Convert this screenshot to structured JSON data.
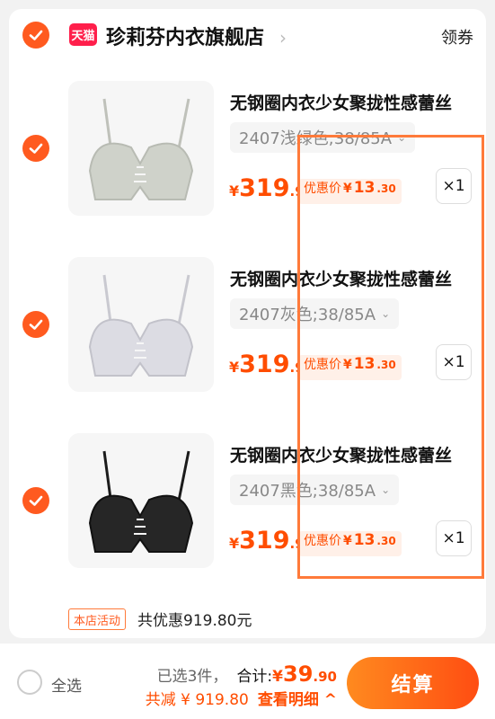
{
  "shop": {
    "badge": "天猫",
    "name": "珍莉芬内衣旗舰店",
    "coupon_label": "领券"
  },
  "items": [
    {
      "title": "无钢圈内衣少女聚拢性感蕾丝",
      "sku": "2407浅绿色;38/85A",
      "price_symbol": "¥",
      "price_int": "319",
      "price_dec": ".9",
      "promo_label": "优惠价",
      "promo_symbol": "¥",
      "promo_int": "13",
      "promo_dec": ".30",
      "qty": "×1",
      "color": "#d4d6cf"
    },
    {
      "title": "无钢圈内衣少女聚拢性感蕾丝",
      "sku": "2407灰色;38/85A",
      "price_symbol": "¥",
      "price_int": "319",
      "price_dec": ".9",
      "promo_label": "优惠价",
      "promo_symbol": "¥",
      "promo_int": "13",
      "promo_dec": ".30",
      "qty": "×1",
      "color": "#dcdce2"
    },
    {
      "title": "无钢圈内衣少女聚拢性感蕾丝",
      "sku": "2407黑色;38/85A",
      "price_symbol": "¥",
      "price_int": "319",
      "price_dec": ".9",
      "promo_label": "优惠价",
      "promo_symbol": "¥",
      "promo_int": "13",
      "promo_dec": ".30",
      "qty": "×1",
      "color": "#222222"
    }
  ],
  "activity": {
    "tag": "本店活动",
    "text": "共优惠919.80元"
  },
  "bottom": {
    "select_all": "全选",
    "selected_count": "已选3件，",
    "total_label": "合计:",
    "total_symbol": "¥",
    "total_int": "39",
    "total_dec": ".90",
    "discount_text": "共减 ¥ 919.80",
    "detail_label": "查看明细 ^",
    "checkout": "结算"
  },
  "colors": {
    "accent": "#ff5a1f",
    "price": "#ff4d00",
    "highlight_box": "#ff7a3a"
  }
}
